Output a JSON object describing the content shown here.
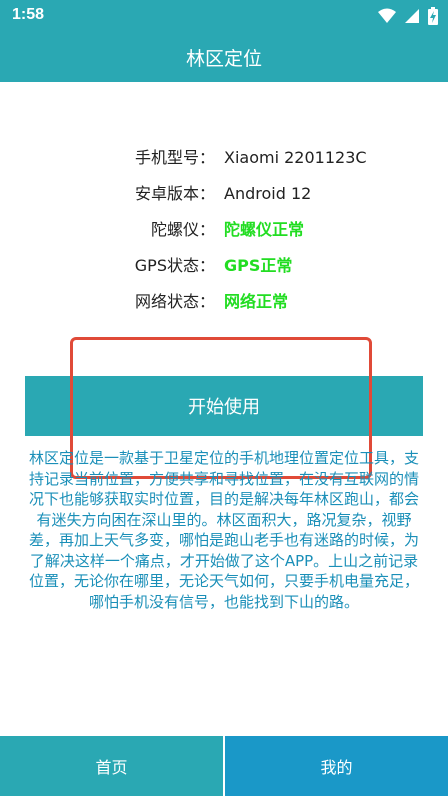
{
  "status_bar": {
    "time": "1:58"
  },
  "app_bar": {
    "title": "林区定位"
  },
  "device_info": [
    {
      "label": "手机型号：",
      "value": "Xiaomi 2201123C",
      "status_ok": false
    },
    {
      "label": "安卓版本：",
      "value": "Android 12",
      "status_ok": false
    },
    {
      "label": "陀螺仪：",
      "value": "陀螺仪正常",
      "status_ok": true
    },
    {
      "label": "GPS状态：",
      "value": "GPS正常",
      "status_ok": true
    },
    {
      "label": "网络状态：",
      "value": "网络正常",
      "status_ok": true
    }
  ],
  "start_button": {
    "label": "开始使用"
  },
  "description": "林区定位是一款基于卫星定位的手机地理位置定位工具，支持记录当前位置，方便共享和寻找位置，在没有互联网的情况下也能够获取实时位置，目的是解决每年林区跑山，都会有迷失方向困在深山里的。林区面积大，路况复杂，视野差，再加上天气多变，哪怕是跑山老手也有迷路的时候，为了解决这样一个痛点，才开始做了这个APP。上山之前记录位置，无论你在哪里，无论天气如何，只要手机电量充足，哪怕手机没有信号，也能找到下山的路。",
  "bottom_nav": {
    "home": "首页",
    "mine": "我的"
  },
  "colors": {
    "primary": "#2aa8b3",
    "status_ok": "#22dd22",
    "description": "#1a8fb8",
    "highlight": "#e04a38"
  }
}
